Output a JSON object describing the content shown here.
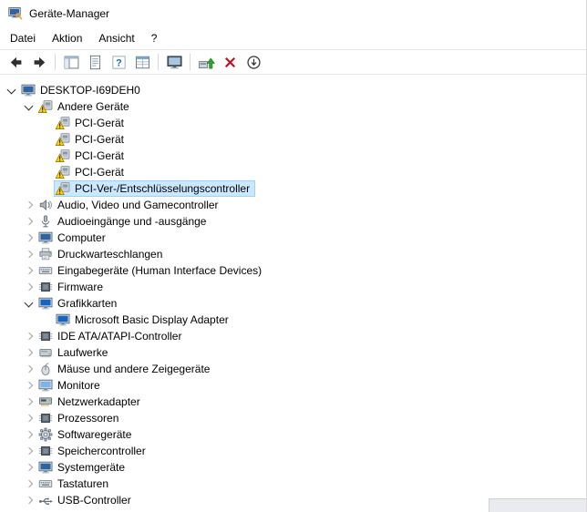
{
  "window": {
    "title": "Geräte-Manager"
  },
  "menu_bar": {
    "items": [
      "Datei",
      "Aktion",
      "Ansicht",
      "?"
    ]
  },
  "toolbar": {
    "buttons": [
      {
        "type": "button",
        "name": "back",
        "icon": "back-arrow-icon"
      },
      {
        "type": "button",
        "name": "forward",
        "icon": "forward-arrow-icon"
      },
      {
        "type": "separator"
      },
      {
        "type": "button",
        "name": "show-console-tree",
        "icon": "console-tree-icon"
      },
      {
        "type": "button",
        "name": "properties",
        "icon": "properties-page-icon"
      },
      {
        "type": "button",
        "name": "help",
        "icon": "help-question-icon"
      },
      {
        "type": "button",
        "name": "export-list",
        "icon": "list-table-icon"
      },
      {
        "type": "separator"
      },
      {
        "type": "button",
        "name": "devices-view",
        "icon": "devices-monitor-icon"
      },
      {
        "type": "separator"
      },
      {
        "type": "button",
        "name": "update-driver",
        "icon": "update-driver-icon"
      },
      {
        "type": "button",
        "name": "uninstall-device",
        "icon": "red-x-icon"
      },
      {
        "type": "button",
        "name": "scan-hardware-changes",
        "icon": "scan-circle-arrow-icon"
      }
    ]
  },
  "tree": {
    "nodes": [
      {
        "label": "DESKTOP-I69DEH0",
        "depth": 0,
        "state": "expanded",
        "icon": "computer-icon"
      },
      {
        "label": "Andere Geräte",
        "depth": 1,
        "state": "expanded",
        "icon": "unknown-device-icon"
      },
      {
        "label": "PCI-Gerät",
        "depth": 2,
        "state": "leaf",
        "icon": "warning-device-icon"
      },
      {
        "label": "PCI-Gerät",
        "depth": 2,
        "state": "leaf",
        "icon": "warning-device-icon"
      },
      {
        "label": "PCI-Gerät",
        "depth": 2,
        "state": "leaf",
        "icon": "warning-device-icon"
      },
      {
        "label": "PCI-Gerät",
        "depth": 2,
        "state": "leaf",
        "icon": "warning-device-icon"
      },
      {
        "label": "PCI-Ver-/Entschlüsselungscontroller",
        "depth": 2,
        "state": "leaf",
        "icon": "warning-device-icon",
        "selected": true
      },
      {
        "label": "Audio, Video und Gamecontroller",
        "depth": 1,
        "state": "collapsed",
        "icon": "audio-controllers-icon"
      },
      {
        "label": "Audioeingänge und -ausgänge",
        "depth": 1,
        "state": "collapsed",
        "icon": "audio-endpoints-icon"
      },
      {
        "label": "Computer",
        "depth": 1,
        "state": "collapsed",
        "icon": "computer-category-icon"
      },
      {
        "label": "Druckwarteschlangen",
        "depth": 1,
        "state": "collapsed",
        "icon": "print-queue-icon"
      },
      {
        "label": "Eingabegeräte (Human Interface Devices)",
        "depth": 1,
        "state": "collapsed",
        "icon": "hid-devices-icon"
      },
      {
        "label": "Firmware",
        "depth": 1,
        "state": "collapsed",
        "icon": "firmware-icon"
      },
      {
        "label": "Grafikkarten",
        "depth": 1,
        "state": "expanded",
        "icon": "display-adapters-icon"
      },
      {
        "label": "Microsoft Basic Display Adapter",
        "depth": 2,
        "state": "leaf",
        "icon": "display-adapter-device-icon"
      },
      {
        "label": "IDE ATA/ATAPI-Controller",
        "depth": 1,
        "state": "collapsed",
        "icon": "ide-controller-icon"
      },
      {
        "label": "Laufwerke",
        "depth": 1,
        "state": "collapsed",
        "icon": "disk-drives-icon"
      },
      {
        "label": "Mäuse und andere Zeigegeräte",
        "depth": 1,
        "state": "collapsed",
        "icon": "mouse-icon"
      },
      {
        "label": "Monitore",
        "depth": 1,
        "state": "collapsed",
        "icon": "monitors-icon"
      },
      {
        "label": "Netzwerkadapter",
        "depth": 1,
        "state": "collapsed",
        "icon": "network-adapters-icon"
      },
      {
        "label": "Prozessoren",
        "depth": 1,
        "state": "collapsed",
        "icon": "processors-icon"
      },
      {
        "label": "Softwaregeräte",
        "depth": 1,
        "state": "collapsed",
        "icon": "software-devices-icon"
      },
      {
        "label": "Speichercontroller",
        "depth": 1,
        "state": "collapsed",
        "icon": "storage-controllers-icon"
      },
      {
        "label": "Systemgeräte",
        "depth": 1,
        "state": "collapsed",
        "icon": "system-devices-icon"
      },
      {
        "label": "Tastaturen",
        "depth": 1,
        "state": "collapsed",
        "icon": "keyboards-icon"
      },
      {
        "label": "USB-Controller",
        "depth": 1,
        "state": "collapsed",
        "icon": "usb-controllers-icon"
      }
    ]
  },
  "appearance": {
    "selection_bg": "#cce8ff",
    "selection_border": "#99d1ff",
    "warning_yellow": "#ffd500",
    "uninstall_red": "#c50f1f"
  }
}
